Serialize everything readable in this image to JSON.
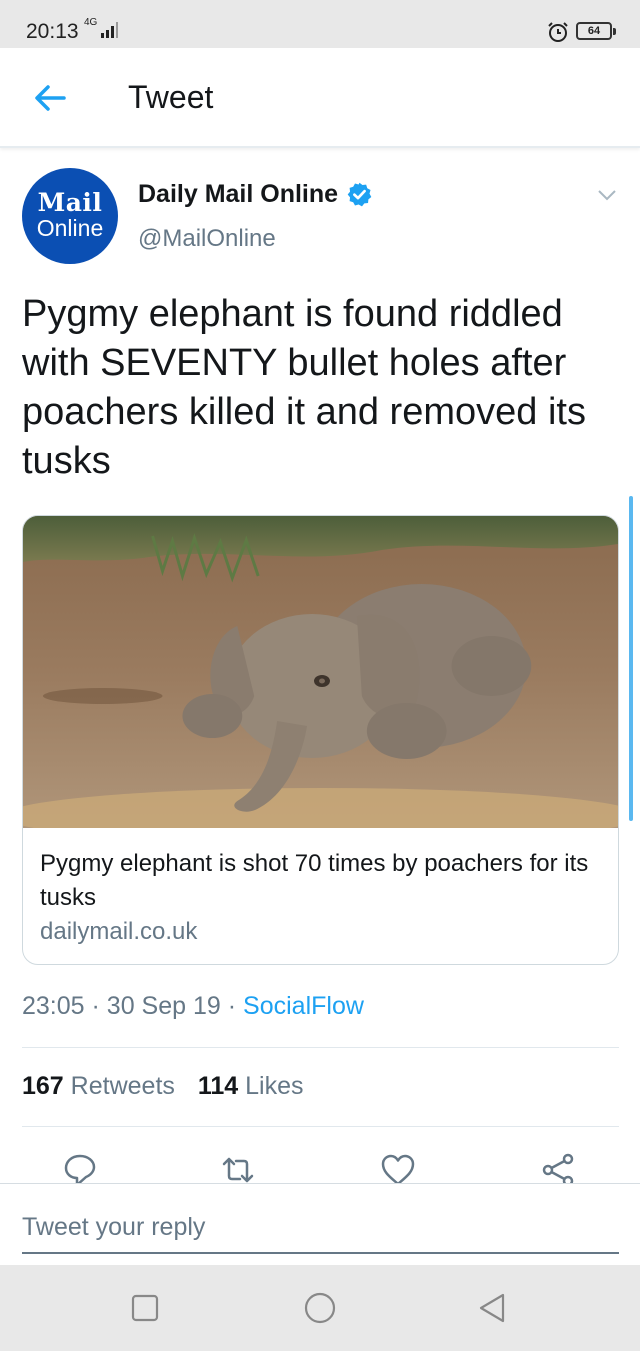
{
  "status_bar": {
    "time": "20:13",
    "network": "4G",
    "battery": "64"
  },
  "header": {
    "title": "Tweet"
  },
  "tweet": {
    "author": {
      "name": "Daily Mail Online",
      "handle": "@MailOnline",
      "avatar_line1": "Mail",
      "avatar_line2": "Online"
    },
    "text": "Pygmy elephant is found riddled with SEVENTY bullet holes after poachers killed it and removed its tusks",
    "card": {
      "title": "Pygmy elephant is shot 70 times by poachers for its tusks",
      "domain": "dailymail.co.uk"
    },
    "time": "23:05",
    "separator": "·",
    "date": "30 Sep 19",
    "source": "SocialFlow",
    "retweets": {
      "count": "167",
      "label": "Retweets"
    },
    "likes": {
      "count": "114",
      "label": "Likes"
    }
  },
  "reply": {
    "placeholder": "Tweet your reply"
  },
  "colors": {
    "accent": "#1da1f2",
    "secondary_text": "#657786",
    "avatar_bg": "#0b4fb3"
  },
  "icons": [
    "back-arrow-icon",
    "verified-badge-icon",
    "chevron-down-icon",
    "reply-icon",
    "retweet-icon",
    "like-heart-icon",
    "share-icon",
    "nav-recents-icon",
    "nav-home-icon",
    "nav-back-icon"
  ]
}
